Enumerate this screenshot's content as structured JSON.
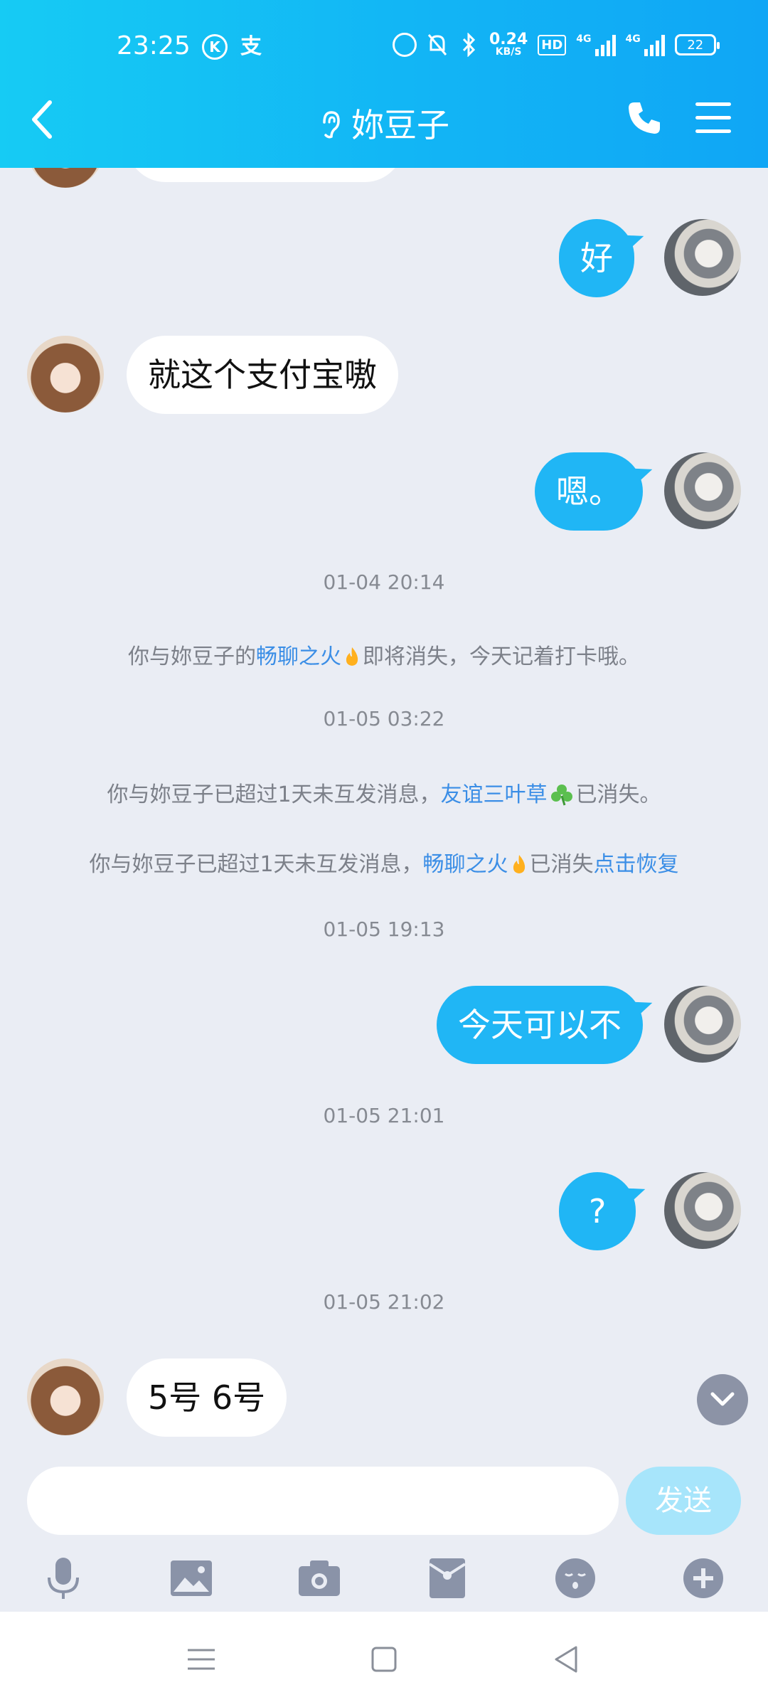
{
  "status_bar": {
    "time": "23:25",
    "k_icon_label": "K",
    "alipay_glyph": "支",
    "net_speed": "0.24",
    "net_unit": "KB/S",
    "hd_label": "HD",
    "sig1_label": "4G",
    "sig2_label": "4G",
    "battery": "22"
  },
  "header": {
    "title": "妳豆子"
  },
  "messages": [
    {
      "side": "left",
      "text": "就这个支付宝嗷"
    },
    {
      "side": "right",
      "text": "好"
    },
    {
      "side": "right",
      "text": "嗯。"
    },
    {
      "side": "right",
      "text": "今天可以不"
    },
    {
      "side": "right",
      "text": "?"
    },
    {
      "side": "left",
      "text": "5号 6号"
    }
  ],
  "timestamps": [
    "01-04 20:14",
    "01-05 03:22",
    "01-05 19:13",
    "01-05 21:01",
    "01-05 21:02"
  ],
  "system": {
    "fire_warn_pre": "你与妳豆子的",
    "fire_warn_link": "畅聊之火",
    "fire_warn_post": "即将消失，今天记着打卡哦。",
    "clover_pre": "你与妳豆子已超过1天未互发消息，",
    "clover_link": "友谊三叶草",
    "clover_post": "已消失。",
    "fire_gone_pre": "你与妳豆子已超过1天未互发消息，",
    "fire_gone_link": "畅聊之火",
    "fire_gone_mid": "已消失",
    "fire_gone_action": "点击恢复"
  },
  "input": {
    "placeholder": "",
    "send_label": "发送"
  },
  "toolbar_icons": [
    "mic-icon",
    "image-icon",
    "camera-icon",
    "red-packet-icon",
    "emoji-icon",
    "plus-icon"
  ],
  "colors": {
    "header": "#12b5f5",
    "bubble_self": "#20b6f5",
    "link": "#3b8ee6",
    "background": "#eaedf4"
  }
}
